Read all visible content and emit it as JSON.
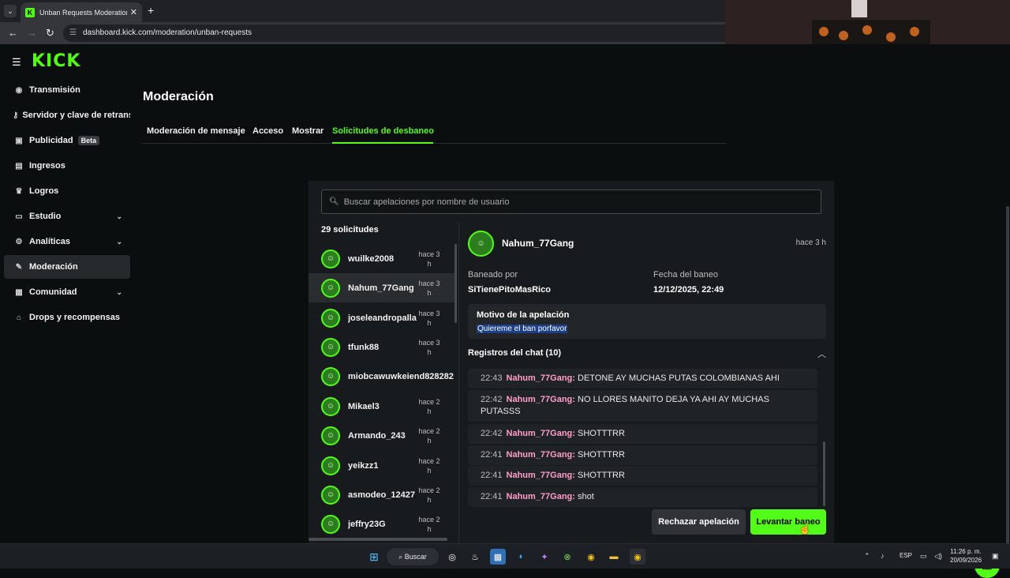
{
  "browser": {
    "tab_title": "Unban Requests Moderation - K",
    "url": "dashboard.kick.com/moderation/unban-requests"
  },
  "brand": {
    "logo": "KICK",
    "accent": "#53fc18"
  },
  "sidebar": {
    "items": [
      {
        "label": "Transmisión",
        "icon": "broadcast-icon"
      },
      {
        "label": "Servidor y clave de retransmisión",
        "icon": "key-icon"
      },
      {
        "label": "Publicidad",
        "icon": "ad-icon",
        "badge": "Beta"
      },
      {
        "label": "Ingresos",
        "icon": "wallet-icon"
      },
      {
        "label": "Logros",
        "icon": "trophy-icon"
      },
      {
        "label": "Estudio",
        "icon": "studio-icon"
      },
      {
        "label": "Analíticas",
        "icon": "analytics-icon"
      },
      {
        "label": "Moderación",
        "icon": "wrench-icon"
      },
      {
        "label": "Comunidad",
        "icon": "community-icon"
      },
      {
        "label": "Drops y recompensas",
        "icon": "gift-icon"
      }
    ]
  },
  "main": {
    "title": "Moderación",
    "tabs": [
      "Moderación de mensaje",
      "Acceso",
      "Mostrar",
      "Solicitudes de desbaneo"
    ],
    "active_tab": "Solicitudes de desbaneo"
  },
  "requests": {
    "search_placeholder": "Buscar apelaciones por nombre de usuario",
    "count_label": "29 solicitudes",
    "items": [
      {
        "user": "wuilke2008",
        "time": "hace 3 h"
      },
      {
        "user": "Nahum_77Gang",
        "time": "hace 3 h"
      },
      {
        "user": "joseleandropalla",
        "time": "hace 3 h"
      },
      {
        "user": "tfunk88",
        "time": "hace 3 h"
      },
      {
        "user": "miobcawuwkeiend828282",
        "time": ""
      },
      {
        "user": "Mikael3",
        "time": "hace 2 h"
      },
      {
        "user": "Armando_243",
        "time": "hace 2 h"
      },
      {
        "user": "yeikzz1",
        "time": "hace 2 h"
      },
      {
        "user": "asmodeo_12427",
        "time": "hace 2 h"
      },
      {
        "user": "jeffry23G",
        "time": "hace 2 h"
      }
    ],
    "selected": "Nahum_77Gang"
  },
  "detail": {
    "user": "Nahum_77Gang",
    "time": "hace 3 h",
    "banned_by_label": "Baneado por",
    "banned_by": "SiTienePitoMasRico",
    "ban_date_label": "Fecha del baneo",
    "ban_date": "12/12/2025, 22:49",
    "appeal_label": "Motivo de la apelación",
    "appeal_text": "Quiereme el ban porfavor",
    "chat_log_label": "Registros del chat (10)",
    "chat": [
      {
        "time": "22:43",
        "user": "Nahum_77Gang",
        "text": "DETONE AY MUCHAS PUTAS COLOMBIANAS AHI"
      },
      {
        "time": "22:42",
        "user": "Nahum_77Gang",
        "text": "NO LLORES MANITO DEJA YA AHI AY MUCHAS PUTASSS"
      },
      {
        "time": "22:42",
        "user": "Nahum_77Gang",
        "text": "SHOTTTRR"
      },
      {
        "time": "22:41",
        "user": "Nahum_77Gang",
        "text": "SHOTTTRR"
      },
      {
        "time": "22:41",
        "user": "Nahum_77Gang",
        "text": "SHOTTTRR"
      },
      {
        "time": "22:41",
        "user": "Nahum_77Gang",
        "text": "shot"
      }
    ],
    "reject_label": "Rechazar apelación",
    "lift_label": "Levantar baneo"
  },
  "taskbar": {
    "search_label": "Buscar",
    "lang": "ESP",
    "time": "11:26 p. m.",
    "date": "20/09/2026"
  }
}
